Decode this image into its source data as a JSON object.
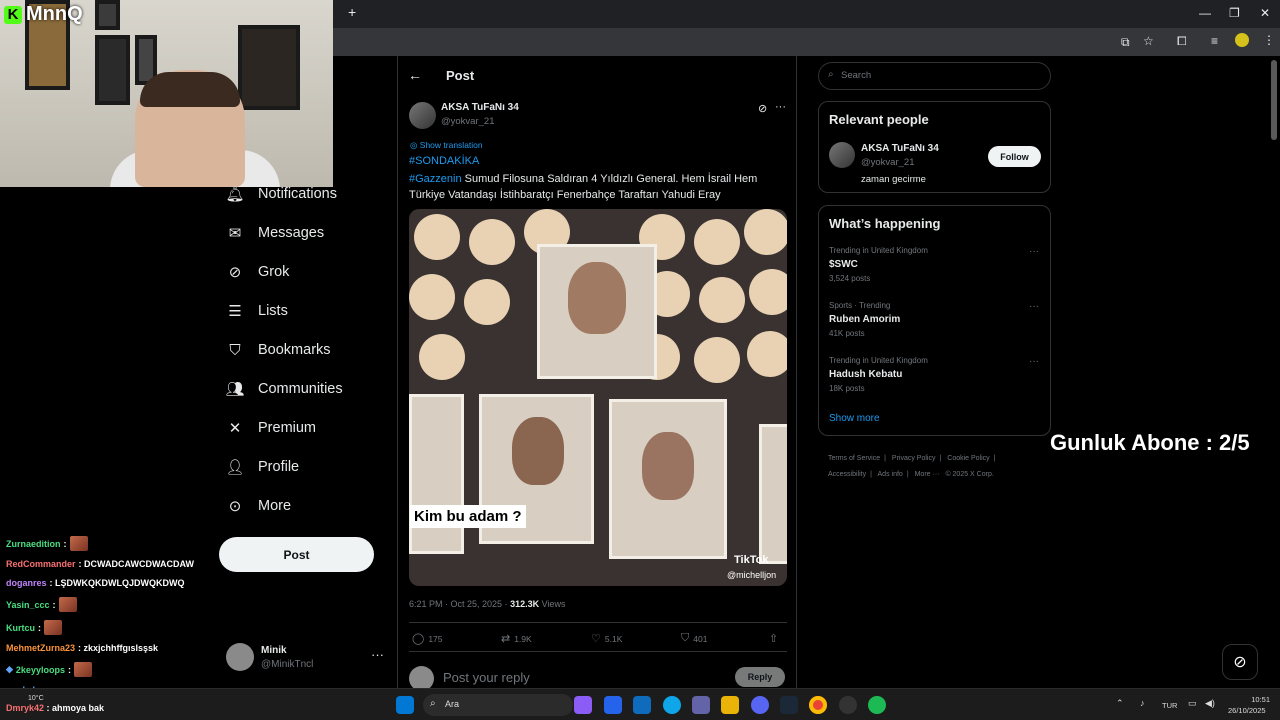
{
  "overlay": {
    "logo_letter": "K",
    "logo_text": "MnnQ",
    "subscriber_counter": "Gunluk Abone : 2/5"
  },
  "browser": {
    "new_tab": "+",
    "minimize": "—",
    "restore": "❐",
    "close": "✕"
  },
  "sidebar": {
    "items": [
      {
        "label": "Notifications",
        "icon": "bell-icon"
      },
      {
        "label": "Messages",
        "icon": "mail-icon"
      },
      {
        "label": "Grok",
        "icon": "grok-icon"
      },
      {
        "label": "Lists",
        "icon": "list-icon"
      },
      {
        "label": "Bookmarks",
        "icon": "bookmark-icon"
      },
      {
        "label": "Communities",
        "icon": "communities-icon"
      },
      {
        "label": "Premium",
        "icon": "x-logo-icon"
      },
      {
        "label": "Profile",
        "icon": "person-icon"
      },
      {
        "label": "More",
        "icon": "more-circle-icon"
      }
    ],
    "post_button": "Post",
    "user": {
      "name": "Minik",
      "handle": "@MinikTncl"
    }
  },
  "post": {
    "header_title": "Post",
    "author_name": "AKSA TuFaNı 34",
    "author_handle": "@yokvar_21",
    "show_translation": "Show translation",
    "hashtag1": "#SONDAKİKA",
    "hashtag2": "#Gazzenin",
    "text": " Sumud Filosuna Saldıran 4 Yıldızlı General. Hem İsrail Hem Türkiye Vatandaşı İstihbaratçı Fenerbahçe Taraftarı Yahudi Eray",
    "media_caption": "Kim bu adam ?",
    "media_watermark": "TikTok",
    "media_watermark_user": "@michelljon",
    "timestamp": "6:21 PM · Oct 25, 2025 · ",
    "views_count": "312.3K",
    "views_label": " Views",
    "replies": "175",
    "reposts": "1.9K",
    "likes": "5.1K",
    "bookmarks": "401",
    "reply_placeholder": "Post your reply",
    "reply_button": "Reply"
  },
  "right": {
    "search_placeholder": "Search",
    "relevant_title": "Relevant people",
    "relevant_person": {
      "name": "AKSA TuFaNı 34",
      "handle": "@yokvar_21",
      "bio": "zaman gecirme",
      "follow": "Follow"
    },
    "happening_title": "What’s happening",
    "trends": [
      {
        "context": "Trending in United Kingdom",
        "name": "$SWC",
        "count": "3,524 posts"
      },
      {
        "context": "Sports · Trending",
        "name": "Ruben Amorim",
        "count": "41K posts"
      },
      {
        "context": "Trending in United Kingdom",
        "name": "Hadush Kebatu",
        "count": "18K posts"
      }
    ],
    "show_more": "Show more",
    "footer": [
      "Terms of Service",
      "|",
      "Privacy Policy",
      "|",
      "Cookie Policy",
      "|",
      "Accessibility",
      "|",
      "Ads info",
      "|",
      "More ···",
      "© 2025 X Corp."
    ]
  },
  "chat": [
    {
      "user": "Zurnaedition",
      "color": "#4ade80",
      "msg": " :",
      "emote": true
    },
    {
      "user": "RedCommander",
      "color": "#f87171",
      "msg": " : DCWADCAWCDWACDAW",
      "emote": false
    },
    {
      "user": "doganres",
      "color": "#c084fc",
      "msg": " : LŞDWKQKDWLQJDWQKDWQ",
      "emote": false
    },
    {
      "user": "Yasin_ccc",
      "color": "#4ade80",
      "msg": " :",
      "emote": true
    },
    {
      "user": "Kurtcu",
      "color": "#4ade80",
      "msg": " :",
      "emote": true
    },
    {
      "user": "MehmetZurna23",
      "color": "#fb923c",
      "msg": " : zkxjchhffgıslsşsk",
      "emote": false
    },
    {
      "user": "2keyyloops",
      "color": "#4ade80",
      "msg": " :",
      "emote": true
    },
    {
      "user": "zwakel",
      "color": "#60a5fa",
      "msg": " : - -",
      "emote": false
    },
    {
      "user": "Dmryk42",
      "color": "#f87171",
      "msg": " : ahmoya bak",
      "emote": false
    }
  ],
  "taskbar": {
    "search_label": "Ara",
    "weather": "10°C",
    "language": "TUR",
    "time": "10:51",
    "date": "26/10/2025"
  },
  "colors": {
    "accent": "#1d9bf0",
    "kick_green": "#53fc18",
    "background": "#000000"
  }
}
